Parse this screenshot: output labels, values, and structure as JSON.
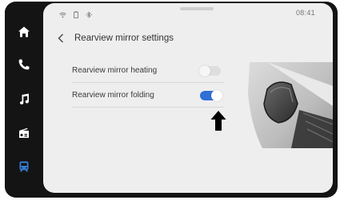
{
  "nav": {
    "items": [
      {
        "name": "home-icon"
      },
      {
        "name": "phone-icon"
      },
      {
        "name": "music-icon"
      },
      {
        "name": "radio-icon"
      },
      {
        "name": "car-icon"
      }
    ],
    "active_color": "#3a7bd5",
    "icon_color": "#ffffff"
  },
  "status_bar": {
    "icons": [
      "wifi-icon",
      "battery-icon",
      "bluetooth-icon"
    ],
    "time": "08:41"
  },
  "page": {
    "back_icon": "chevron-left-icon",
    "title": "Rearview mirror settings"
  },
  "settings": [
    {
      "label": "Rearview mirror heating",
      "enabled": false
    },
    {
      "label": "Rearview mirror folding",
      "enabled": true
    }
  ],
  "colors": {
    "toggle_on": "#2f6fd6",
    "toggle_off": "#dedede",
    "screen_bg": "#eeeeee",
    "bezel": "#141414"
  }
}
